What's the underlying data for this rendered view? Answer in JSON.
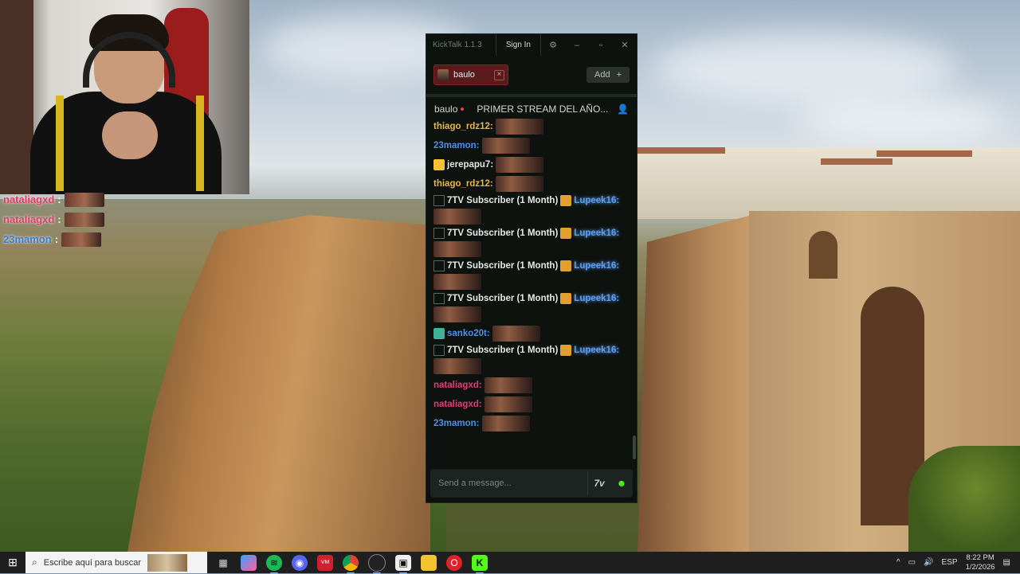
{
  "overlay_chat": [
    {
      "name": "nataliagxd",
      "sep": ":",
      "color": "#e23b6a"
    },
    {
      "name": "nataliagxd",
      "sep": ":",
      "color": "#e23b6a"
    },
    {
      "name": "23mamon",
      "sep": ":",
      "color": "#3a7bd5"
    }
  ],
  "kicktalk": {
    "title": "KickTalk 1.1.3",
    "sign_in": "Sign In",
    "tab": {
      "label": "baulo",
      "close": "×"
    },
    "add_label": "Add",
    "add_icon": "+",
    "channel": {
      "name": "baulo",
      "stream_title": "PRIMER STREAM DEL AÑO..."
    },
    "messages": [
      {
        "user": "thiago_rdz12:",
        "color": "#e5b84a",
        "badge": null,
        "sub": false
      },
      {
        "user": "23mamon:",
        "color": "#4f8fe8",
        "badge": null,
        "sub": false
      },
      {
        "user": "jerepapu7:",
        "color": "#e4e8e6",
        "badge": "crown",
        "sub": false
      },
      {
        "user": "thiago_rdz12:",
        "color": "#e5b84a",
        "badge": null,
        "sub": false
      },
      {
        "user": "Lupeek16:",
        "color": "#5b9cf0",
        "badge": "founder",
        "sub": true,
        "sub_text": "7TV Subscriber (1 Month)"
      },
      {
        "user": "Lupeek16:",
        "color": "#5b9cf0",
        "badge": "founder",
        "sub": true,
        "sub_text": "7TV Subscriber (1 Month)"
      },
      {
        "user": "Lupeek16:",
        "color": "#5b9cf0",
        "badge": "founder",
        "sub": true,
        "sub_text": "7TV Subscriber (1 Month)"
      },
      {
        "user": "Lupeek16:",
        "color": "#5b9cf0",
        "badge": "founder",
        "sub": true,
        "sub_text": "7TV Subscriber (1 Month)"
      },
      {
        "user": "sanko20t:",
        "color": "#4f8fe8",
        "badge": "sub",
        "sub": false
      },
      {
        "user": "Lupeek16:",
        "color": "#5b9cf0",
        "badge": "founder",
        "sub": true,
        "sub_text": "7TV Subscriber (1 Month)"
      },
      {
        "user": "nataliagxd:",
        "color": "#e83a78",
        "badge": null,
        "sub": false
      },
      {
        "user": "nataliagxd:",
        "color": "#e83a78",
        "badge": null,
        "sub": false
      },
      {
        "user": "23mamon:",
        "color": "#4f8fe8",
        "badge": null,
        "sub": false
      }
    ],
    "input_placeholder": "Send a message..."
  },
  "taskbar": {
    "search_placeholder": "Escribe aquí para buscar",
    "language": "ESP",
    "time": "8:22 PM",
    "date": "1/2/2026"
  },
  "colors": {
    "kick_green": "#53fc18",
    "window_bg": "#0d120f",
    "tab_red": "#5a1a1a"
  }
}
